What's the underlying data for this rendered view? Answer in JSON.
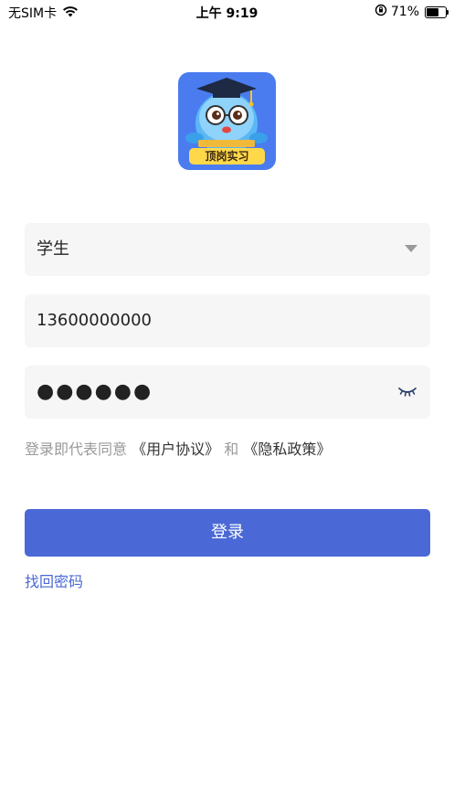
{
  "status_bar": {
    "carrier": "无SIM卡",
    "time": "上午 9:19",
    "battery_text": "71%",
    "battery_level": 0.71,
    "icons": [
      "wifi-icon",
      "rotation-lock-icon",
      "battery-icon"
    ]
  },
  "logo": {
    "badge_text": "顶岗实习"
  },
  "form": {
    "role_value": "学生",
    "phone_value": "13600000000",
    "password_value": "●●●●●●"
  },
  "agreement": {
    "prefix": "登录即代表同意",
    "user_agreement": "《用户协议》",
    "and": "和",
    "privacy_policy": "《隐私政策》"
  },
  "login_label": "登录",
  "forgot_password_label": "找回密码",
  "colors": {
    "primary": "#4a68d6",
    "field_bg": "#f6f6f6",
    "hint_text": "#999999"
  }
}
